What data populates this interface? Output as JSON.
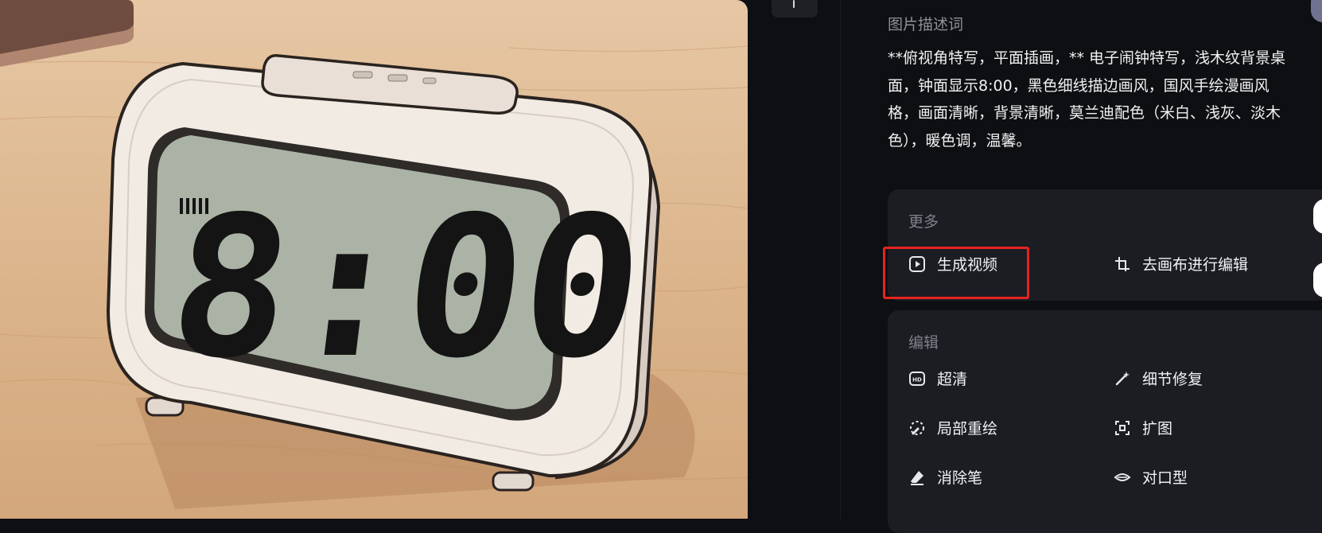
{
  "image": {
    "clock_time": "8:00"
  },
  "prompt": {
    "title": "图片描述词",
    "text": "**俯视角特写，平面插画，** 电子闹钟特写，浅木纹背景桌\n面，钟面显示8:00，黑色细线描边画风，国风手绘漫画风\n格，画面清晰，背景清晰，莫兰迪配色（米白、浅灰、淡木\n色），暖色调，温馨。"
  },
  "more": {
    "title": "更多",
    "generate_video": "生成视频",
    "canvas_edit": "去画布进行编辑"
  },
  "edit": {
    "title": "编辑",
    "upscale": "超清",
    "detail_fix": "细节修复",
    "inpaint": "局部重绘",
    "expand": "扩图",
    "eraser": "消除笔",
    "lip_sync": "对口型"
  },
  "colors": {
    "highlight": "#e8231f",
    "background": "#0e0f12",
    "card": "#1c1d22"
  }
}
